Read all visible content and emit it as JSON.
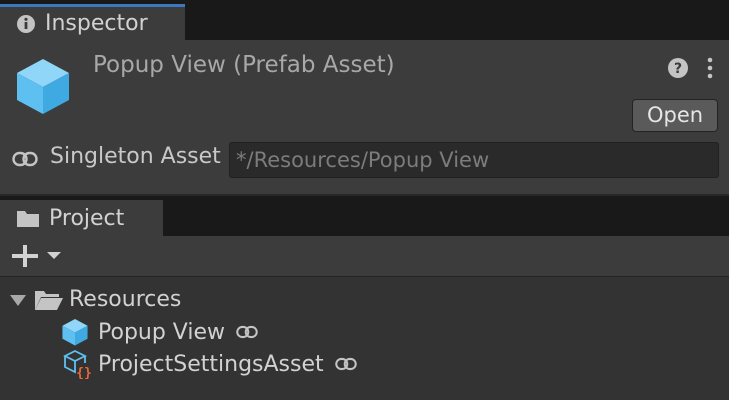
{
  "inspector": {
    "tab_label": "Inspector",
    "asset_title": "Popup View (Prefab Asset)",
    "open_button": "Open",
    "singleton_label": "Singleton Asset",
    "singleton_value": "*/Resources/Popup View"
  },
  "project": {
    "tab_label": "Project",
    "tree": [
      {
        "label": "Resources",
        "icon": "folder-open-icon",
        "expanded": true
      },
      {
        "label": "Popup View",
        "icon": "prefab-cube-icon",
        "linked": true
      },
      {
        "label": "ProjectSettingsAsset",
        "icon": "scriptable-object-icon",
        "linked": true
      }
    ]
  },
  "colors": {
    "accent": "#3a79bb",
    "prefab": "#5ec0f0",
    "script_badge": "#e8663a"
  }
}
